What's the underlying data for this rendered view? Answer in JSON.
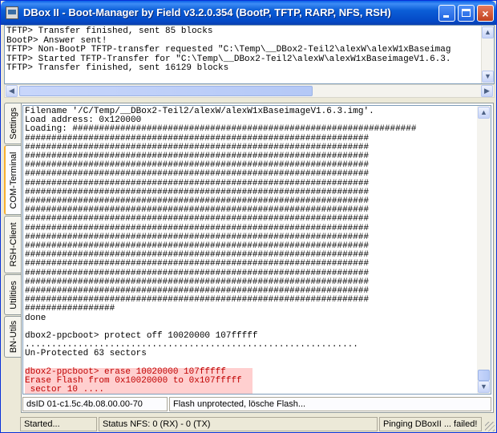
{
  "window": {
    "title": "DBox II - Boot-Manager by Field v3.2.0.354 (BootP, TFTP, RARP, NFS, RSH)",
    "buttons": {
      "minimize": "minimize-icon",
      "maximize": "maximize-icon",
      "close": "×"
    }
  },
  "log": {
    "lines": [
      "TFTP> Transfer finished, sent 85 blocks",
      "BootP> Answer sent!",
      "TFTP> Non-BootP TFTP-transfer requested \"C:\\Temp\\__DBox2-Teil2\\alexW\\alexW1xBaseimag",
      "TFTP> Started TFTP-Transfer for \"C:\\Temp\\__DBox2-Teil2\\alexW\\alexW1xBaseimageV1.6.3.",
      "TFTP> Transfer finished, sent 16129 blocks"
    ]
  },
  "tabs": [
    "Settings",
    "COM-Terminal",
    "RSH-Client",
    "Utilities",
    "BN-Utils"
  ],
  "terminal": {
    "header_lines": [
      "Filename '/C/Temp/__DBox2-Teil2/alexW/alexW1xBaseimageV1.6.3.img'.",
      "Load address: 0x120000",
      "Loading: #################################################################"
    ],
    "hash_line": "#################################################################",
    "last_hash_line": "#################",
    "after_lines": [
      "done",
      "",
      "dbox2-ppcboot> protect off 10020000 107fffff",
      "...............................................................",
      "Un-Protected 63 sectors",
      ""
    ],
    "highlight_lines": [
      "dbox2-ppcboot> erase 10020000 107fffff",
      "Erase Flash from 0x10020000 to 0x107fffff",
      " sector 10 ...."
    ]
  },
  "info": {
    "dsid": "dsID 01-c1.5c.4b.08.00.00-70",
    "message": "Flash unprotected, lösche Flash..."
  },
  "status": {
    "left": "Started...",
    "nfs": "Status NFS: 0 (RX) - 0 (TX)",
    "right": "Pinging DBoxII ... failed!"
  }
}
